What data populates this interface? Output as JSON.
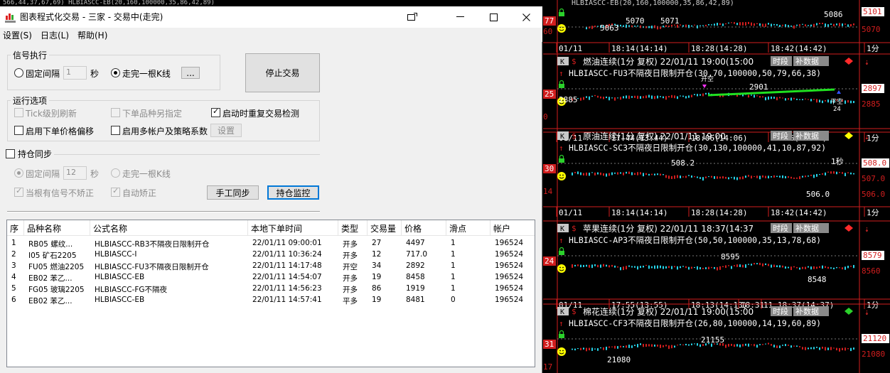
{
  "top_strip": "566,44,37,67,69)     HLBIASCC-EB(20,160,100000,35,86,42,89)",
  "window": {
    "title": "图表程式化交易 - 三家 - 交易中(走完)",
    "icon_caption": "QUANT"
  },
  "menu": [
    {
      "label": "设置(S)"
    },
    {
      "label": "日志(L)"
    },
    {
      "label": "帮助(H)"
    }
  ],
  "signal_exec": {
    "legend": "信号执行",
    "fixed_interval_label": "固定间隔",
    "fixed_interval_value": "1",
    "seconds_unit": "秒",
    "bar_complete_label": "走完一根K线",
    "ellipsis_button": "...",
    "selected": "bar_complete"
  },
  "stop_trading_button": "停止交易",
  "run_options": {
    "legend": "运行选项",
    "tick_refresh": "Tick级别刷新",
    "order_other_instrument": "下单品种另指定",
    "restart_check": "启动时重复交易检测",
    "price_offset": "启用下单价格偏移",
    "multi_account": "启用多帐户及策略系数",
    "settings_button": "设置",
    "restart_check_checked": true
  },
  "position_sync": {
    "label": "持仓同步",
    "fixed_interval_label": "固定间隔",
    "fixed_interval_value": "12",
    "seconds_unit": "秒",
    "bar_complete_label": "走完一根K线",
    "no_correct_label": "当根有信号不矫正",
    "auto_correct_label": "自动矫正",
    "manual_sync_button": "手工同步",
    "position_monitor_button": "持仓监控"
  },
  "table": {
    "columns": [
      "序",
      "品种名称",
      "公式名称",
      "本地下单时间",
      "类型",
      "交易量",
      "价格",
      "滑点",
      "帐户"
    ],
    "rows": [
      [
        "1",
        "RB05 螺纹...",
        "HLBIASCC-RB3不隔夜日限制开仓",
        "22/01/11 09:00:01",
        "开多",
        "27",
        "4497",
        "1",
        "196524"
      ],
      [
        "2",
        "I05 矿石2205",
        "HLBIASCC-I",
        "22/01/11 10:36:24",
        "开多",
        "12",
        "717.0",
        "1",
        "196524"
      ],
      [
        "3",
        "FU05 燃油2205",
        "HLBIASCC-FU3不隔夜日限制开仓",
        "22/01/11 14:17:48",
        "开空",
        "34",
        "2892",
        "1",
        "196524"
      ],
      [
        "4",
        "EB02 苯乙...",
        "HLBIASCC-EB",
        "22/01/11 14:54:07",
        "开多",
        "19",
        "8458",
        "1",
        "196524"
      ],
      [
        "5",
        "FG05 玻璃2205",
        "HLBIASCC-FG不隔夜",
        "22/01/11 14:56:23",
        "开多",
        "86",
        "1919",
        "1",
        "196524"
      ],
      [
        "6",
        "EB02 苯乙...",
        "HLBIASCC-EB",
        "22/01/11 14:57:41",
        "平多",
        "19",
        "8481",
        "0",
        "196524"
      ]
    ]
  },
  "charts": {
    "top_panel": {
      "header": "HLBIASCC-EB(20,160,100000,35,86,42,89)",
      "labels": [
        "5063",
        "5070",
        "5071",
        "5086"
      ],
      "left_ticks": [
        "77",
        "60"
      ],
      "right_ticks": [
        "5101",
        "5070"
      ],
      "time_axis": [
        "01/11",
        "18:14(14:14)",
        "18:28(14:28)",
        "18:42(14:42)",
        "1分"
      ]
    },
    "panels": [
      {
        "k_btn": "K",
        "name": "燃油连续(1分 复权) 22/01/11 19:00(15:00",
        "formula": "HLBIASCC-FU3不隔夜日限制开仓(30,70,100000,50,79,66,38)",
        "labels": [
          "2885",
          "2901",
          "开空",
          "平空",
          "24"
        ],
        "left_ticks": [
          "25",
          "0"
        ],
        "right_ticks": [
          "2897",
          "2885"
        ],
        "time_axis": [
          "01/11",
          "17:44(13:44)",
          "18:06(14:06)",
          "18:26(14:26)",
          "1分"
        ],
        "btn_shiduan": "时段",
        "btn_buju": "补数据"
      },
      {
        "k_btn": "K",
        "name": "原油连续(1分 复权) 22/01/11 19:00",
        "formula": "HLBIASCC-SC3不隔夜日限制开仓(30,130,100000,41,10,87,92)",
        "labels": [
          "508.2",
          "1秒",
          "506.0"
        ],
        "left_ticks": [
          "30",
          "14"
        ],
        "right_ticks": [
          "508.0",
          "507.0",
          "506.0"
        ],
        "time_axis": [
          "01/11",
          "18:14(14:14)",
          "18:28(14:28)",
          "18:42(14:42)",
          "1分"
        ],
        "btn_shiduan": "时段",
        "btn_buju": "补数据"
      },
      {
        "k_btn": "K",
        "name": "苹果连续(1分 复权) 22/01/11 18:37(14:37",
        "formula": "HLBIASCC-AP3不隔夜日限制开仓(50,50,100000,35,13,78,68)",
        "labels": [
          "8595",
          "8548"
        ],
        "left_ticks": [
          "24"
        ],
        "right_ticks": [
          "8579",
          "8560"
        ],
        "time_axis": [
          "01/11",
          "17:55(13:55)",
          "18:13(14:13)",
          "18:31",
          "11 18:37(14:37)",
          "1分"
        ],
        "btn_shiduan": "时段",
        "btn_buju": "补数据"
      },
      {
        "k_btn": "K",
        "name": "棉花连续(1分 复权) 22/01/11 19:00(15:00",
        "formula": "HLBIASCC-CF3不隔夜日限制开仓(26,80,100000,14,19,60,89)",
        "labels": [
          "21155",
          "21080"
        ],
        "left_ticks": [
          "31",
          "17"
        ],
        "right_ticks": [
          "21120",
          "21080"
        ],
        "btn_shiduan": "时段",
        "btn_buju": "补数据"
      }
    ]
  }
}
